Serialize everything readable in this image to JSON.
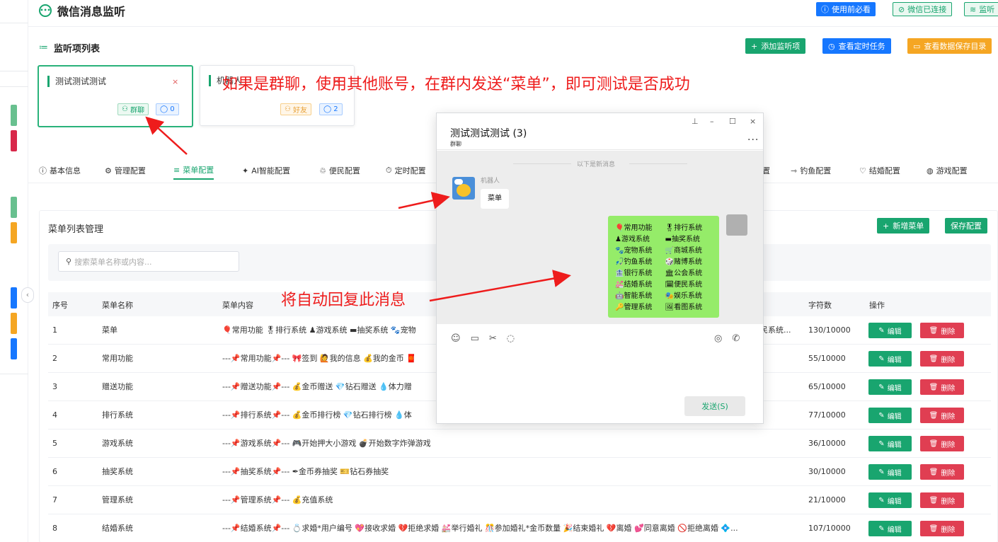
{
  "app": {
    "title": "微信消息监听",
    "header_buttons": [
      {
        "label": "使用前必看",
        "icon": "ⓘ"
      },
      {
        "label": "微信已连接",
        "icon": "⊘"
      },
      {
        "label": "监听",
        "icon": "≋"
      }
    ]
  },
  "monitor_list": {
    "title": "监听项列表",
    "icon": "≔",
    "buttons": [
      {
        "label": "添加监听项",
        "icon": "+"
      },
      {
        "label": "查看定时任务",
        "icon": "◷"
      },
      {
        "label": "查看数据保存目录",
        "icon": "▭"
      }
    ],
    "cards": [
      {
        "name": "测试测试测试",
        "close": "×",
        "tag": "群聊",
        "tag_icon": "⚇",
        "count": "0",
        "count_icon": "◯"
      },
      {
        "name": "机器人",
        "close": "×",
        "tag": "好友",
        "tag_icon": "⚇",
        "count": "2",
        "count_icon": "◯"
      }
    ]
  },
  "annotations": {
    "top": "如果是群聊，使用其他账号，在群内发送“菜单”，即可测试是否成功",
    "middle": "将自动回复此消息"
  },
  "tabs": [
    {
      "label": "基本信息",
      "icon": "ⓘ"
    },
    {
      "label": "管理配置",
      "icon": "⚙"
    },
    {
      "label": "菜单配置",
      "icon": "≡"
    },
    {
      "label": "AI智能配置",
      "icon": "✦"
    },
    {
      "label": "便民配置",
      "icon": "♲"
    },
    {
      "label": "定时配置",
      "icon": "⏱"
    },
    {
      "label": "置",
      "icon": ""
    },
    {
      "label": "钓鱼配置",
      "icon": "⇾"
    },
    {
      "label": "结婚配置",
      "icon": "♡"
    },
    {
      "label": "游戏配置",
      "icon": "◍"
    }
  ],
  "menu_list": {
    "title": "菜单列表管理",
    "add_button": {
      "label": "新增菜单",
      "icon": "+"
    },
    "save_button": "保存配置",
    "search_placeholder": "搜索菜单名称或内容...",
    "search_icon": "⚲",
    "columns": [
      "序号",
      "菜单名称",
      "菜单内容",
      "字符数",
      "操作"
    ],
    "edit_label": "编辑",
    "edit_icon": "✎",
    "delete_label": "删除",
    "delete_icon": "🗑",
    "rows": [
      {
        "no": "1",
        "name": "菜单",
        "content": "🎈常用功能 🎖排行系统 ♟游戏系统 ▬抽奖系统 🐾宠物",
        "tail": "民系统...",
        "chars": "130/10000"
      },
      {
        "no": "2",
        "name": "常用功能",
        "content": "---📌常用功能📌--- 🎀签到 🙋我的信息 💰我的金币 🧧",
        "tail": "",
        "chars": "55/10000"
      },
      {
        "no": "3",
        "name": "赠送功能",
        "content": "---📌赠送功能📌--- 💰金币赠送 💎钻石赠送 💧体力赠",
        "tail": "",
        "chars": "65/10000"
      },
      {
        "no": "4",
        "name": "排行系统",
        "content": "---📌排行系统📌--- 💰金币排行榜 💎钻石排行榜 💧体",
        "tail": "",
        "chars": "77/10000"
      },
      {
        "no": "5",
        "name": "游戏系统",
        "content": "---📌游戏系统📌--- 🎮开始押大小游戏 💣开始数字炸弹游戏",
        "tail": "",
        "chars": "36/10000"
      },
      {
        "no": "6",
        "name": "抽奖系统",
        "content": "---📌抽奖系统📌--- ✒金币券抽奖 🎫钻石券抽奖",
        "tail": "",
        "chars": "30/10000"
      },
      {
        "no": "7",
        "name": "管理系统",
        "content": "---📌管理系统📌--- 💰充值系统",
        "tail": "",
        "chars": "21/10000"
      },
      {
        "no": "8",
        "name": "结婚系统",
        "content": "---📌结婚系统📌--- 💍求婚*用户编号 💖接收求婚 💔拒绝求婚 💒举行婚礼 🎊参加婚礼*金币数量 🎉结束婚礼 💔离婚 💕同意离婚 🚫拒绝离婚 💠...",
        "tail": "",
        "chars": "107/10000"
      }
    ]
  },
  "chat": {
    "title": "测试测试测试 (3)",
    "subtitle": "群聊",
    "window_controls": [
      "⊥",
      "–",
      "☐",
      "×"
    ],
    "more": "...",
    "divider": "以下是新消息",
    "bot_name": "机器人",
    "incoming": "菜单",
    "reply_items": [
      "🎈常用功能",
      "🎖排行系统",
      "♟游戏系统",
      "▬抽奖系统",
      "🐾宠物系统",
      "🛒商城系统",
      "🎣钓鱼系统",
      "🎲赌博系统",
      "🏦银行系统",
      "🏛公会系统",
      "💒结婚系统",
      "🗓便民系统",
      "🤖智能系统",
      "🎭娱乐系统",
      "🔑管理系统",
      "🖼看图系统"
    ],
    "toolbar_left": [
      "☺",
      "▭",
      "✂",
      "◌"
    ],
    "toolbar_right": [
      "◎",
      "✆"
    ],
    "send": "发送(S)"
  },
  "colors": {
    "accent": "#19a56f",
    "blue": "#1677ff",
    "danger": "#e03e52",
    "annotation": "#ee1c1c",
    "bubble": "#95ec69"
  }
}
